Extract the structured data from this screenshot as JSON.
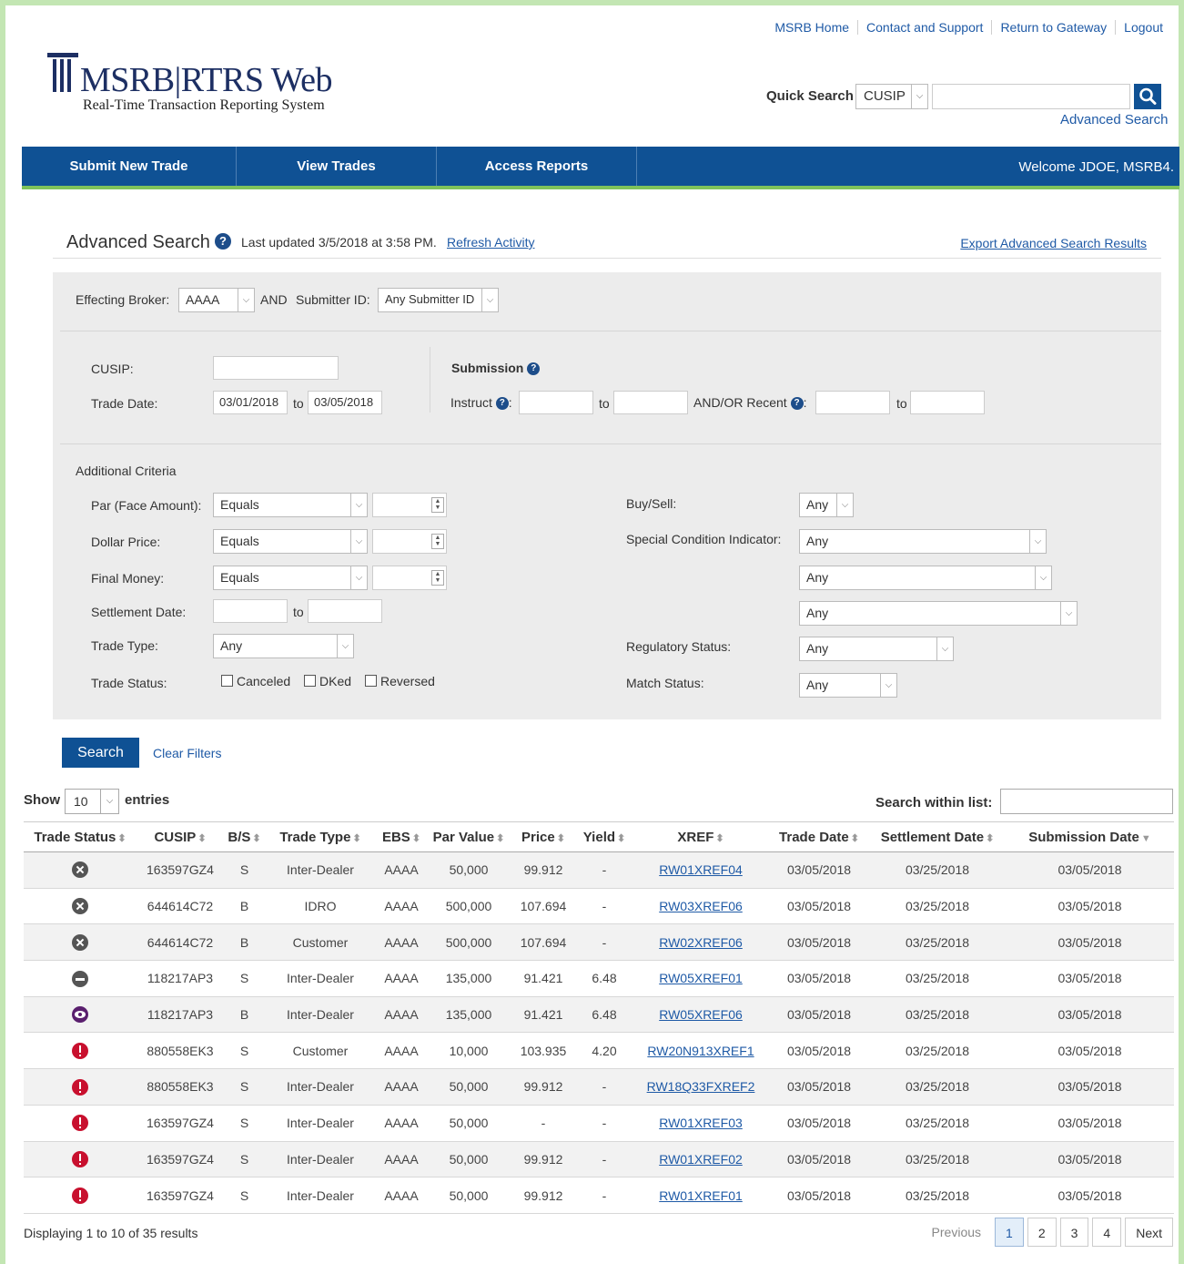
{
  "top_links": [
    "MSRB Home",
    "Contact and Support",
    "Return to Gateway",
    "Logout"
  ],
  "logo": {
    "title": "MSRB|RTRS Web",
    "subtitle": "Real-Time Transaction Reporting System"
  },
  "quick_search": {
    "label": "Quick Search",
    "type": "CUSIP",
    "value": "",
    "advanced_link": "Advanced Search"
  },
  "nav": {
    "submit": "Submit New Trade",
    "view": "View Trades",
    "reports": "Access Reports",
    "welcome": "Welcome JDOE, MSRB4."
  },
  "header": {
    "title": "Advanced Search",
    "help": "?",
    "updated": "Last updated 3/5/2018 at 3:58 PM.",
    "refresh": "Refresh Activity",
    "export": "Export Advanced Search Results"
  },
  "filters": {
    "effecting_broker_label": "Effecting Broker:",
    "effecting_broker": "AAAA",
    "and": "AND",
    "submitter_label": "Submitter ID:",
    "submitter": "Any Submitter ID",
    "cusip_label": "CUSIP:",
    "cusip": "",
    "trade_date_label": "Trade Date:",
    "trade_date_from": "03/01/2018",
    "to": "to",
    "trade_date_to": "03/05/2018",
    "submission_label": "Submission",
    "instruct_label": "Instruct",
    "andor_recent_label": "AND/OR  Recent",
    "additional_label": "Additional Criteria",
    "par_label": "Par (Face Amount):",
    "par_op": "Equals",
    "price_label": "Dollar Price:",
    "price_op": "Equals",
    "money_label": "Final Money:",
    "money_op": "Equals",
    "settle_label": "Settlement Date:",
    "trade_type_label": "Trade Type:",
    "trade_type": "Any",
    "trade_status_label": "Trade Status:",
    "status_canceled": "Canceled",
    "status_dked": "DKed",
    "status_reversed": "Reversed",
    "buysell_label": "Buy/Sell:",
    "buysell": "Any",
    "sci_label": "Special Condition Indicator:",
    "sci_1": "Any",
    "sci_2": "Any",
    "sci_3": "Any",
    "reg_label": "Regulatory Status:",
    "reg": "Any",
    "match_label": "Match Status:",
    "match": "Any",
    "search_btn": "Search",
    "clear": "Clear Filters"
  },
  "list_controls": {
    "show": "Show",
    "entries_value": "10",
    "entries": "entries",
    "search_within": "Search within list:"
  },
  "table": {
    "headers": [
      "Trade Status",
      "CUSIP",
      "B/S",
      "Trade Type",
      "EBS",
      "Par Value",
      "Price",
      "Yield",
      "XREF",
      "Trade Date",
      "Settlement Date",
      "Submission Date"
    ],
    "rows": [
      {
        "status": "canceled",
        "cusip": "163597GZ4",
        "bs": "S",
        "type": "Inter-Dealer",
        "ebs": "AAAA",
        "par": "50,000",
        "price": "99.912",
        "yield": "-",
        "xref": "RW01XREF04",
        "trade_date": "03/05/2018",
        "settle_date": "03/25/2018",
        "sub_date": "03/05/2018"
      },
      {
        "status": "canceled",
        "cusip": "644614C72",
        "bs": "B",
        "type": "IDRO",
        "ebs": "AAAA",
        "par": "500,000",
        "price": "107.694",
        "yield": "-",
        "xref": "RW03XREF06",
        "trade_date": "03/05/2018",
        "settle_date": "03/25/2018",
        "sub_date": "03/05/2018"
      },
      {
        "status": "canceled",
        "cusip": "644614C72",
        "bs": "B",
        "type": "Customer",
        "ebs": "AAAA",
        "par": "500,000",
        "price": "107.694",
        "yield": "-",
        "xref": "RW02XREF06",
        "trade_date": "03/05/2018",
        "settle_date": "03/25/2018",
        "sub_date": "03/05/2018"
      },
      {
        "status": "dked",
        "cusip": "118217AP3",
        "bs": "S",
        "type": "Inter-Dealer",
        "ebs": "AAAA",
        "par": "135,000",
        "price": "91.421",
        "yield": "6.48",
        "xref": "RW05XREF01",
        "trade_date": "03/05/2018",
        "settle_date": "03/25/2018",
        "sub_date": "03/05/2018"
      },
      {
        "status": "reversed",
        "cusip": "118217AP3",
        "bs": "B",
        "type": "Inter-Dealer",
        "ebs": "AAAA",
        "par": "135,000",
        "price": "91.421",
        "yield": "6.48",
        "xref": "RW05XREF06",
        "trade_date": "03/05/2018",
        "settle_date": "03/25/2018",
        "sub_date": "03/05/2018"
      },
      {
        "status": "error",
        "cusip": "880558EK3",
        "bs": "S",
        "type": "Customer",
        "ebs": "AAAA",
        "par": "10,000",
        "price": "103.935",
        "yield": "4.20",
        "xref": "RW20N913XREF1",
        "trade_date": "03/05/2018",
        "settle_date": "03/25/2018",
        "sub_date": "03/05/2018"
      },
      {
        "status": "error",
        "cusip": "880558EK3",
        "bs": "S",
        "type": "Inter-Dealer",
        "ebs": "AAAA",
        "par": "50,000",
        "price": "99.912",
        "yield": "-",
        "xref": "RW18Q33FXREF2",
        "trade_date": "03/05/2018",
        "settle_date": "03/25/2018",
        "sub_date": "03/05/2018"
      },
      {
        "status": "error",
        "cusip": "163597GZ4",
        "bs": "S",
        "type": "Inter-Dealer",
        "ebs": "AAAA",
        "par": "50,000",
        "price": "-",
        "yield": "-",
        "xref": "RW01XREF03",
        "trade_date": "03/05/2018",
        "settle_date": "03/25/2018",
        "sub_date": "03/05/2018"
      },
      {
        "status": "error",
        "cusip": "163597GZ4",
        "bs": "S",
        "type": "Inter-Dealer",
        "ebs": "AAAA",
        "par": "50,000",
        "price": "99.912",
        "yield": "-",
        "xref": "RW01XREF02",
        "trade_date": "03/05/2018",
        "settle_date": "03/25/2018",
        "sub_date": "03/05/2018"
      },
      {
        "status": "error",
        "cusip": "163597GZ4",
        "bs": "S",
        "type": "Inter-Dealer",
        "ebs": "AAAA",
        "par": "50,000",
        "price": "99.912",
        "yield": "-",
        "xref": "RW01XREF01",
        "trade_date": "03/05/2018",
        "settle_date": "03/25/2018",
        "sub_date": "03/05/2018"
      }
    ]
  },
  "footer": {
    "info": "Displaying 1 to 10 of 35 results",
    "previous": "Previous",
    "pages": [
      "1",
      "2",
      "3",
      "4"
    ],
    "next": "Next"
  },
  "colors": {
    "brand_blue": "#0f5194",
    "accent_green": "#7fc35b",
    "link": "#1f5aa6",
    "error_red": "#c8102e"
  }
}
